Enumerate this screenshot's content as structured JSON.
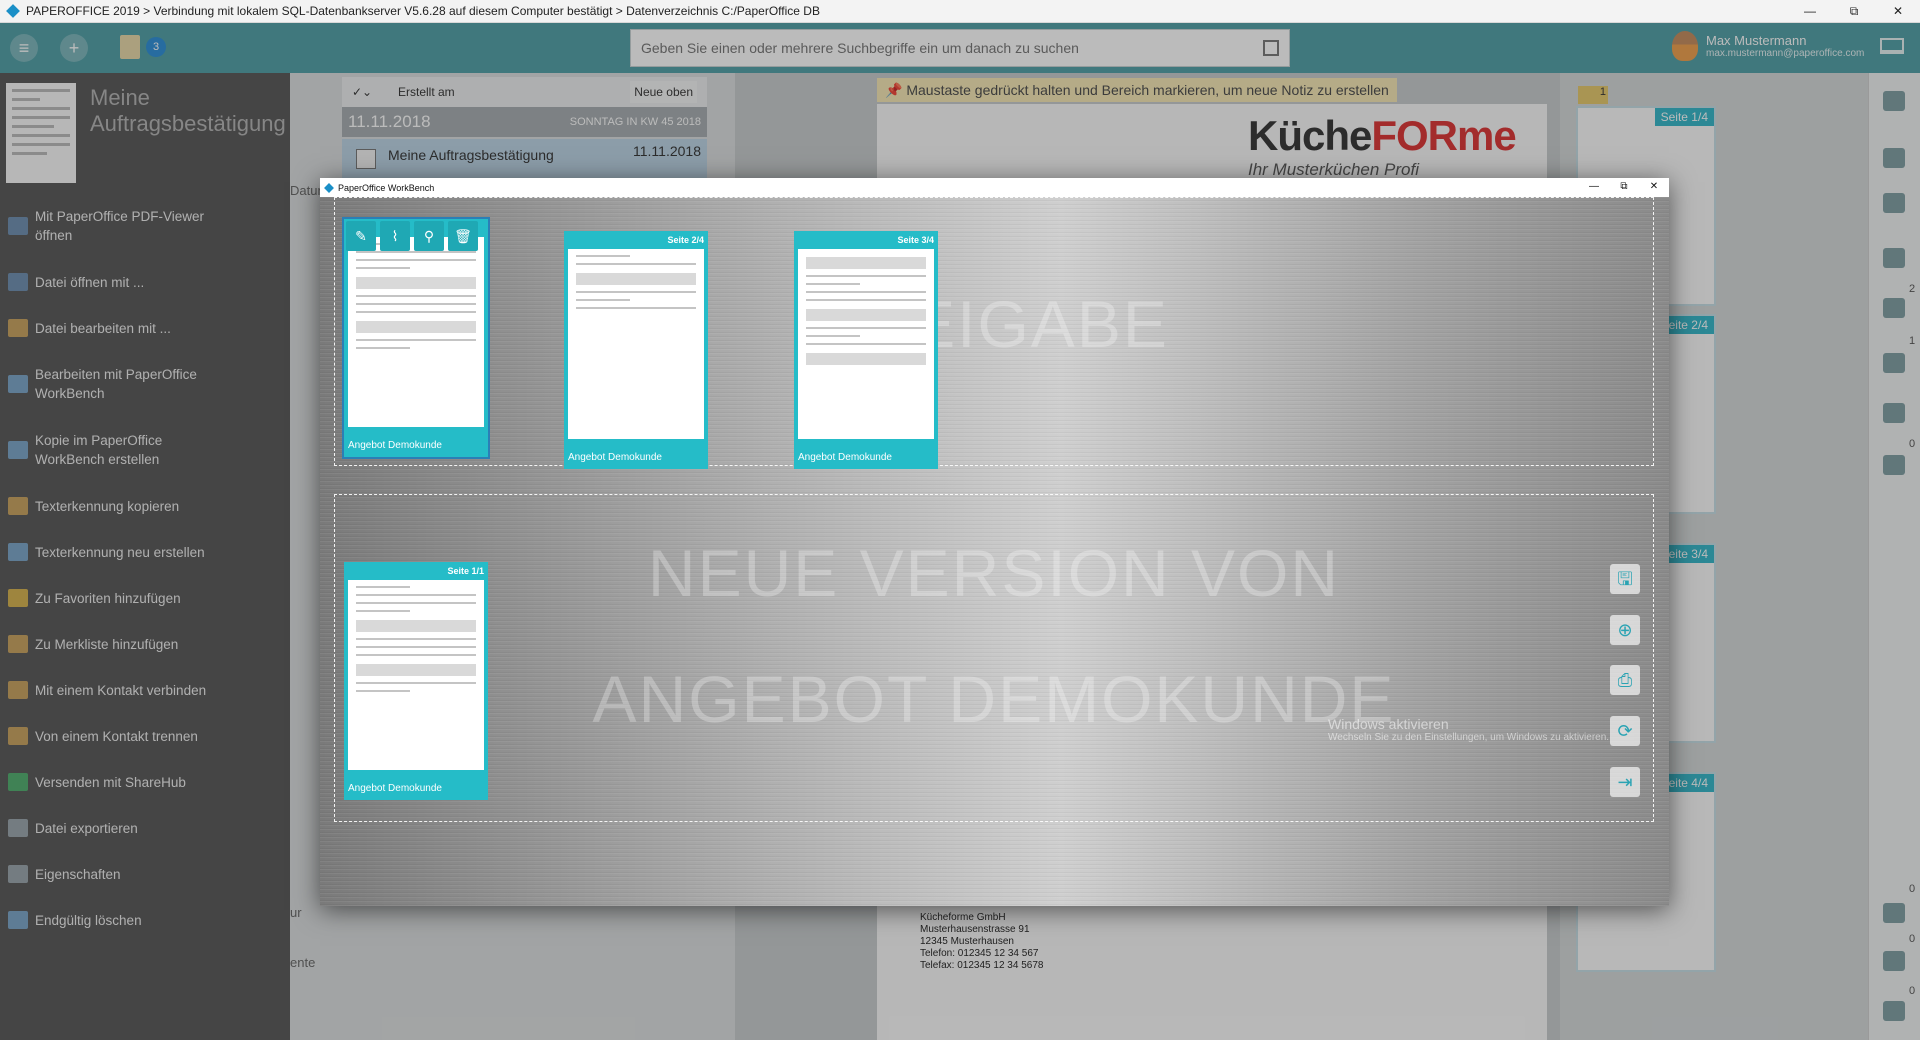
{
  "window": {
    "title": "PAPEROFFICE 2019 > Verbindung mit lokalem SQL-Datenbankserver V5.6.28 auf diesem Computer bestätigt > Datenverzeichnis C:/PaperOffice DB",
    "minimize": "—",
    "maximize": "⧉",
    "close": "✕"
  },
  "toolbar": {
    "badge_count": "3",
    "search_placeholder": "Geben Sie einen oder mehrere Suchbegriffe ein um danach zu suchen",
    "user_name": "Max Mustermann",
    "user_email": "max.mustermann@paperoffice.com"
  },
  "sidebar": {
    "document_title": "Meine Auftragsbestätigung",
    "menu": [
      {
        "label": "Mit PaperOffice PDF-Viewer öffnen",
        "icon": "pdf-viewer-icon",
        "color": "#6d8fb0"
      },
      {
        "label": "Datei öffnen mit ...",
        "icon": "open-file-icon",
        "color": "#6d8fb0"
      },
      {
        "label": "Datei bearbeiten mit ...",
        "icon": "edit-file-icon",
        "color": "#c9a35e"
      },
      {
        "label": "Bearbeiten mit PaperOffice WorkBench",
        "icon": "workbench-icon",
        "color": "#7aa5c9"
      },
      {
        "label": "Kopie im PaperOffice WorkBench erstellen",
        "icon": "copy-workbench-icon",
        "color": "#7aa5c9"
      },
      {
        "label": "Texterkennung kopieren",
        "icon": "ocr-copy-icon",
        "color": "#c9a35e"
      },
      {
        "label": "Texterkennung neu erstellen",
        "icon": "ocr-new-icon",
        "color": "#7aa5c9"
      },
      {
        "label": "Zu Favoriten hinzufügen",
        "icon": "star-icon",
        "color": "#d6b24d"
      },
      {
        "label": "Zu Merkliste hinzufügen",
        "icon": "bookmark-icon",
        "color": "#c9a35e"
      },
      {
        "label": "Mit einem Kontakt verbinden",
        "icon": "contact-link-icon",
        "color": "#c9a35e"
      },
      {
        "label": "Von einem Kontakt trennen",
        "icon": "contact-unlink-icon",
        "color": "#c9a35e"
      },
      {
        "label": "Versenden mit ShareHub",
        "icon": "sharehub-icon",
        "color": "#4fae6d"
      },
      {
        "label": "Datei exportieren",
        "icon": "export-icon",
        "color": "#9aa5ad"
      },
      {
        "label": "Eigenschaften",
        "icon": "properties-icon",
        "color": "#9aa5ad"
      },
      {
        "label": "Endgültig löschen",
        "icon": "delete-icon",
        "color": "#7aa5c9"
      }
    ]
  },
  "list": {
    "sort_label": "Erstellt am",
    "order_label": "Neue oben",
    "group_date": "11.11.2018",
    "group_week": "SONNTAG IN KW 45 2018",
    "row_title": "Meine Auftragsbestätigung",
    "row_date": "11.11.2018",
    "side_labels": [
      "Datur",
      "ur",
      "ente"
    ]
  },
  "viewer": {
    "hint": "Maustaste gedrückt halten und Bereich markieren, um neue Notiz zu erstellen",
    "logo_text": "Küche",
    "logo_accent": "FORme",
    "logo_tagline": "Ihr Musterküchen Profi",
    "address": [
      "Kücheforme GmbH",
      "Musterhausenstrasse 91",
      "12345 Musterhausen",
      "Telefon: 012345 12 34 567",
      "Telefax: 012345 12 34 5678"
    ]
  },
  "thumbnails": {
    "flag_count": "1",
    "pages": [
      "Seite 1/4",
      "Seite 2/4",
      "Seite 3/4",
      "Seite 4/4"
    ]
  },
  "rail": {
    "counts": [
      "2",
      "1",
      "0",
      "0",
      "0",
      "0"
    ]
  },
  "workbench": {
    "title": "PaperOffice WorkBench",
    "zone1_label": "FREIGABE",
    "zone2_line1": "NEUE VERSION VON",
    "zone2_line2": "ANGEBOT DEMOKUNDE",
    "cards_top": [
      {
        "page": "",
        "name": "Angebot Demokunde"
      },
      {
        "page": "Seite 2/4",
        "name": "Angebot Demokunde"
      },
      {
        "page": "Seite 3/4",
        "name": "Angebot Demokunde"
      }
    ],
    "card_bottom": {
      "page": "Seite 1/1",
      "name": "Angebot Demokunde"
    },
    "card_tools": [
      "✎",
      "⌇",
      "⚲",
      "🗑"
    ],
    "side_actions": [
      "save-icon",
      "add-icon",
      "print-icon",
      "refresh-icon",
      "export-icon"
    ],
    "activation_title": "Windows aktivieren",
    "activation_text": "Wechseln Sie zu den Einstellungen, um Windows zu aktivieren."
  }
}
